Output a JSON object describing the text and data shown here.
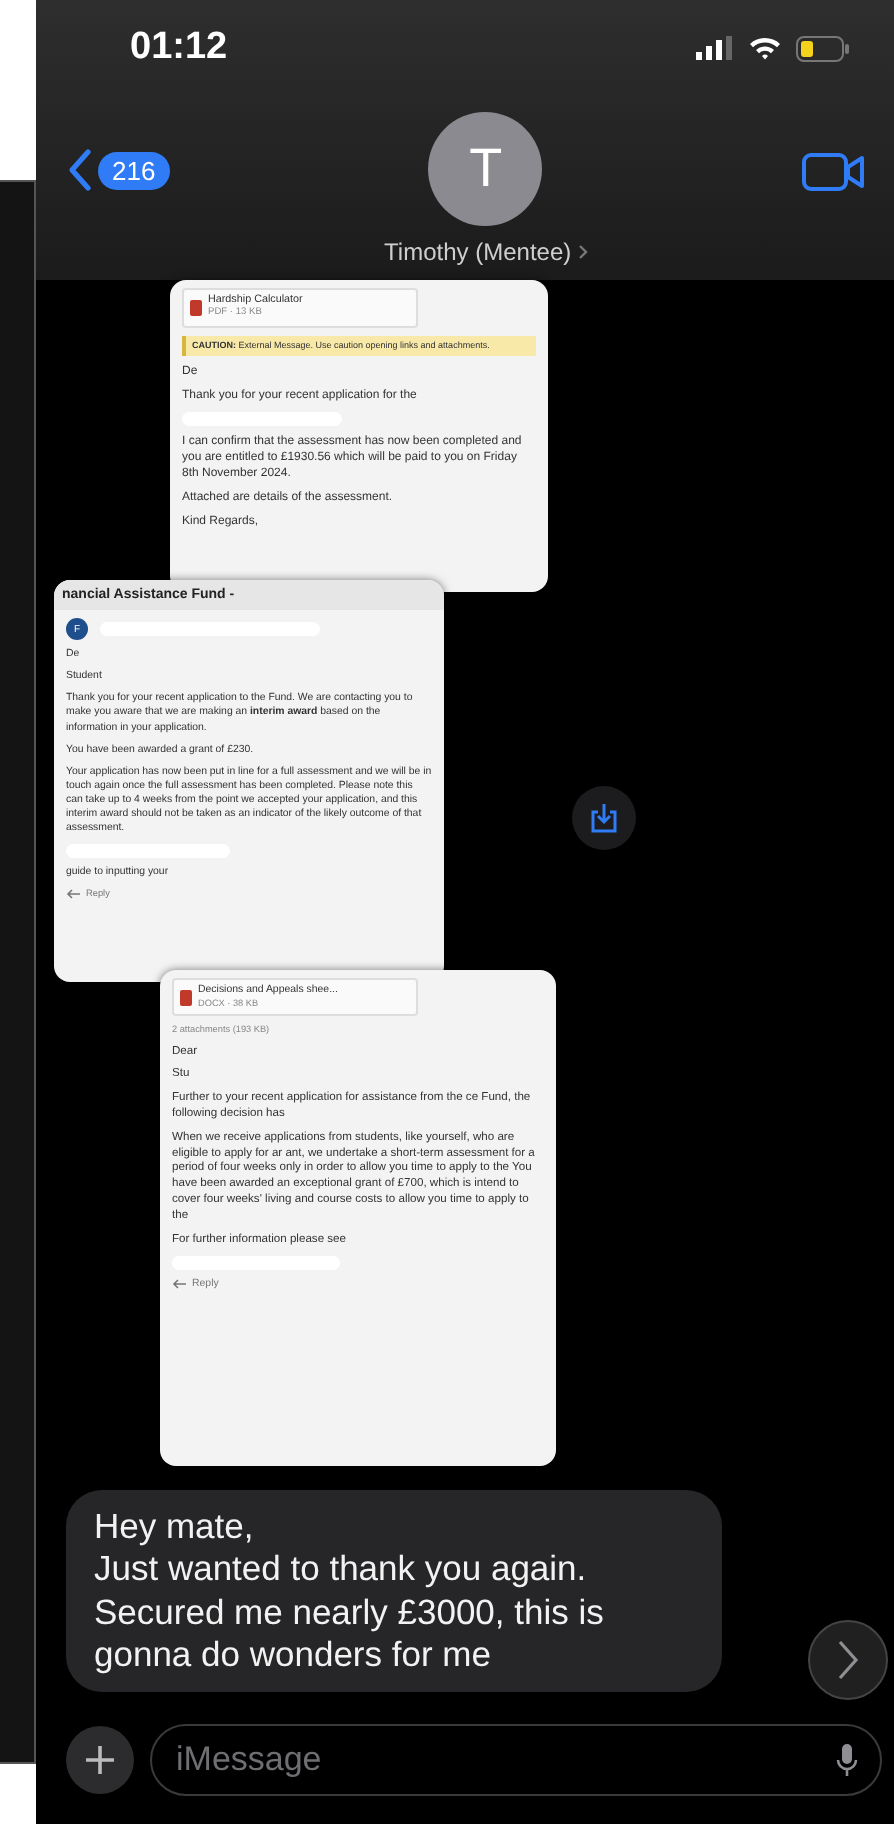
{
  "status_bar": {
    "time": "01:12"
  },
  "header": {
    "back_count": "216",
    "avatar_initial": "T",
    "contact_name": "Timothy (Mentee)"
  },
  "attachments": [
    {
      "kind": "email",
      "blocks": [
        {
          "kind": "file",
          "name": "Hardship Calculator",
          "meta": "PDF · 13 KB"
        },
        {
          "kind": "caution",
          "text": "**CAUTION:** External Message. Use caution opening links and attachments."
        },
        {
          "kind": "greeting",
          "text": "De"
        },
        {
          "kind": "paragraph",
          "text": "Thank you for your recent application for the"
        },
        {
          "kind": "redacted"
        },
        {
          "kind": "paragraph",
          "text": "I can confirm that the assessment has now been completed and you are entitled to £1930.56 which will be paid to you on Friday 8th November 2024."
        },
        {
          "kind": "paragraph",
          "text": "Attached are details of the assessment."
        },
        {
          "kind": "paragraph",
          "text": "Kind Regards,"
        }
      ]
    },
    {
      "kind": "email",
      "title": "nancial Assistance Fund -",
      "sender_initial": "F",
      "blocks": [
        {
          "kind": "greeting",
          "text": "De"
        },
        {
          "kind": "greeting",
          "text": "Student"
        },
        {
          "kind": "paragraph",
          "text": "Thank you for your recent application to the Fund. We are contacting you to make you aware that we are making an **interim award** based on the information in your application."
        },
        {
          "kind": "paragraph",
          "text": "You have been awarded a grant of £230."
        },
        {
          "kind": "paragraph",
          "text": "Your application has now been put in line for a full assessment and we will be in touch again once the full assessment has been completed. Please note this can take up to 4 weeks from the point we accepted your application, and this interim award should not be taken as an indicator of the likely outcome of that assessment."
        },
        {
          "kind": "redacted"
        },
        {
          "kind": "paragraph",
          "text": "guide to inputting your"
        },
        {
          "kind": "reply",
          "text": "Reply"
        }
      ]
    },
    {
      "kind": "email",
      "blocks": [
        {
          "kind": "file",
          "name": "Decisions and Appeals shee...",
          "meta": "DOCX · 38 KB"
        },
        {
          "kind": "meta",
          "text": "2 attachments (193 KB)"
        },
        {
          "kind": "greeting",
          "text": "Dear"
        },
        {
          "kind": "greeting",
          "text": "Stu"
        },
        {
          "kind": "paragraph",
          "text": "Further to your recent application for assistance from the ce Fund, the following decision has"
        },
        {
          "kind": "paragraph",
          "text": "When we receive applications from students, like yourself, who are eligible to apply for ar ant, we undertake a short-term assessment for a period of four weeks only in order to allow you time to apply to the You have been awarded an exceptional grant of £700, which is intend to cover four weeks' living and course costs to allow you time to apply to the"
        },
        {
          "kind": "paragraph",
          "text": "For further information please see"
        },
        {
          "kind": "redacted"
        },
        {
          "kind": "reply",
          "text": "Reply"
        }
      ]
    }
  ],
  "message": {
    "text": "Hey mate,\nJust wanted to thank you again.\nSecured me nearly £3000, this is\ngonna do wonders for me"
  },
  "composer": {
    "placeholder": "iMessage"
  }
}
